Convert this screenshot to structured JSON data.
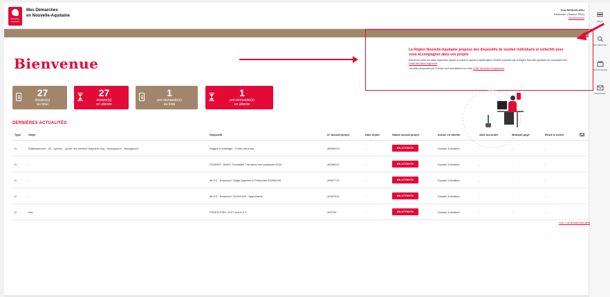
{
  "header": {
    "logo_text": [
      "Nouvelle-",
      "Aquitaine"
    ],
    "title_line1": "Mes Démarches",
    "title_line2": "en Nouvelle-Aquitaine",
    "user_name": "Test REGION-SRU",
    "user_role": "Particulier (Testeur SRU)",
    "logout": "Déconnexion"
  },
  "sidebar": {
    "menu": "MENU",
    "search": "RECHERCHE",
    "account": "RESSOURCES",
    "messages": "MESSAGES"
  },
  "main": {
    "welcome": "Bienvenue",
    "info": {
      "title": "La Région Nouvelle-Aquitaine propose des dispositifs de soutien individuels et collectifs pour vous accompagner dans vos projets",
      "text1": "Retrouvez toutes les aides régionales, appels à projets et appels à manifestation d'intérêt proposés par la Région Nouvelle-Aquitaine en consultant notre",
      "link1": "Guide des Aides régionales",
      "text2": "Les aides proposées par l'Europe sont consultables sur notre",
      "link2": "Guide des Aides européennes"
    },
    "cards": [
      {
        "num": "27",
        "l1": "dossier(s)",
        "l2": "au total"
      },
      {
        "num": "27",
        "l1": "dossier(s)",
        "l2": "en attente"
      },
      {
        "num": "1",
        "l1": "pré-demande(s)",
        "l2": "au total"
      },
      {
        "num": "1",
        "l1": "pré-demande(s)",
        "l2": "en attente"
      }
    ],
    "section_title": "DERNIÈRES ACTUALITÉS",
    "table": {
      "headers": {
        "type": "Type",
        "objet": "Objet",
        "dispositif": "Dispositif",
        "num": "N° dossier/projet",
        "date": "Date dépôt",
        "statut": "Statut dossier/projet",
        "action": "Action en attente",
        "aide": "Aide accordée",
        "montant": "Montant payé",
        "reste": "Reste à verser"
      },
      "rows": [
        {
          "type": "D",
          "objet": "Établissement : 23 - Lycéen - Lycée des métiers Delphine Gay - Bourganeuf - Bourganeuf",
          "dispositif": "Stages à l'étranger - Public infra bac",
          "num": "48906310",
          "date": "-",
          "statut": "EN ATTENTE",
          "action": "Dossier à finaliser",
          "aide": "-",
          "montant": "-",
          "reste": "-"
        },
        {
          "type": "D",
          "objet": "-",
          "dispositif": "FEADER - MAEC Forfaitaire Transition des pratiques 2025",
          "num": "46188110",
          "date": "-",
          "statut": "EN ATTENTE",
          "action": "Dossier à finaliser",
          "aide": "-",
          "montant": "-",
          "reste": "-"
        },
        {
          "type": "D",
          "objet": "-",
          "dispositif": "MI-VS - Erasmus+ Stage Apprenti & Personnel 2025/2026",
          "num": "49947710",
          "date": "-",
          "statut": "EN ATTENTE",
          "action": "Dossier à finaliser",
          "aide": "-",
          "montant": "-",
          "reste": "-"
        },
        {
          "type": "D",
          "objet": "-",
          "dispositif": "MI-VS - Erasmus+ 2025/2026 - Apprenants",
          "num": "49387510",
          "date": "-",
          "statut": "EN ATTENTE",
          "action": "Dossier à finaliser",
          "aide": "-",
          "montant": "-",
          "reste": "-"
        },
        {
          "type": "D",
          "objet": "test",
          "dispositif": "FEDER-FSE+-2127 Axe 4-4.1",
          "num": "493730",
          "date": "-",
          "statut": "EN ATTENTE",
          "action": "Dossier à finaliser",
          "aide": "-",
          "montant": "-",
          "reste": "-"
        }
      ],
      "footer_link": "Voir + de dossiers/projets"
    }
  },
  "colors": {
    "accent_red": "#e30a38",
    "brown": "#a2866c"
  }
}
